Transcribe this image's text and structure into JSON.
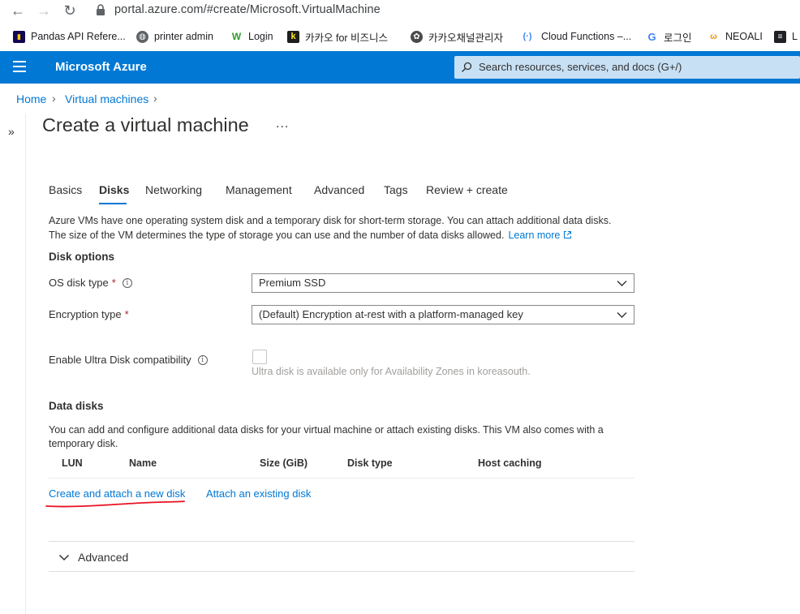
{
  "browser": {
    "url": "portal.azure.com/#create/Microsoft.VirtualMachine",
    "bookmarks": [
      {
        "label": "Pandas API Refere...",
        "icon": "pandas-icon"
      },
      {
        "label": "printer admin",
        "icon": "globe-icon"
      },
      {
        "label": "Login",
        "icon": "w-logo-icon"
      },
      {
        "label": "카카오 for 비즈니스",
        "icon": "kakao-k-icon"
      },
      {
        "label": "카카오채널관리자",
        "icon": "channel-icon"
      },
      {
        "label": "Cloud Functions –...",
        "icon": "cloud-functions-icon"
      },
      {
        "label": "로그인",
        "icon": "google-g-icon"
      },
      {
        "label": "NEOALI",
        "icon": "neoali-icon"
      },
      {
        "label": "L",
        "icon": "doc-icon"
      }
    ]
  },
  "topbar": {
    "brand": "Microsoft Azure",
    "search_placeholder": "Search resources, services, and docs (G+/)"
  },
  "breadcrumb": [
    "Home",
    "Virtual machines"
  ],
  "page": {
    "title": "Create a virtual machine",
    "more": "...",
    "tabs": [
      "Basics",
      "Disks",
      "Networking",
      "Management",
      "Advanced",
      "Tags",
      "Review + create"
    ],
    "active_tab": "Disks",
    "intro_line1": "Azure VMs have one operating system disk and a temporary disk for short-term storage. You can attach additional data disks.",
    "intro_line2": "The size of the VM determines the type of storage you can use and the number of data disks allowed.",
    "learn_more": "Learn more"
  },
  "disk_options": {
    "heading": "Disk options",
    "os_disk_label": "OS disk type",
    "os_disk_value": "Premium SSD",
    "encryption_label": "Encryption type",
    "encryption_value": "(Default) Encryption at-rest with a platform-managed key",
    "ultra_label": "Enable Ultra Disk compatibility",
    "ultra_helper": "Ultra disk is available only for Availability Zones in koreasouth.",
    "required_mark": "*"
  },
  "data_disks": {
    "heading": "Data disks",
    "desc_line1": "You can add and configure additional data disks for your virtual machine or attach existing disks. This VM also comes with a",
    "desc_line2": "temporary disk.",
    "columns": [
      "LUN",
      "Name",
      "Size (GiB)",
      "Disk type",
      "Host caching"
    ],
    "create_link": "Create and attach a new disk",
    "attach_link": "Attach an existing disk"
  },
  "advanced": {
    "label": "Advanced"
  },
  "colors": {
    "azure_blue": "#0078d4",
    "search_bg": "#c7e0f4",
    "annotation_red": "#e81123"
  }
}
